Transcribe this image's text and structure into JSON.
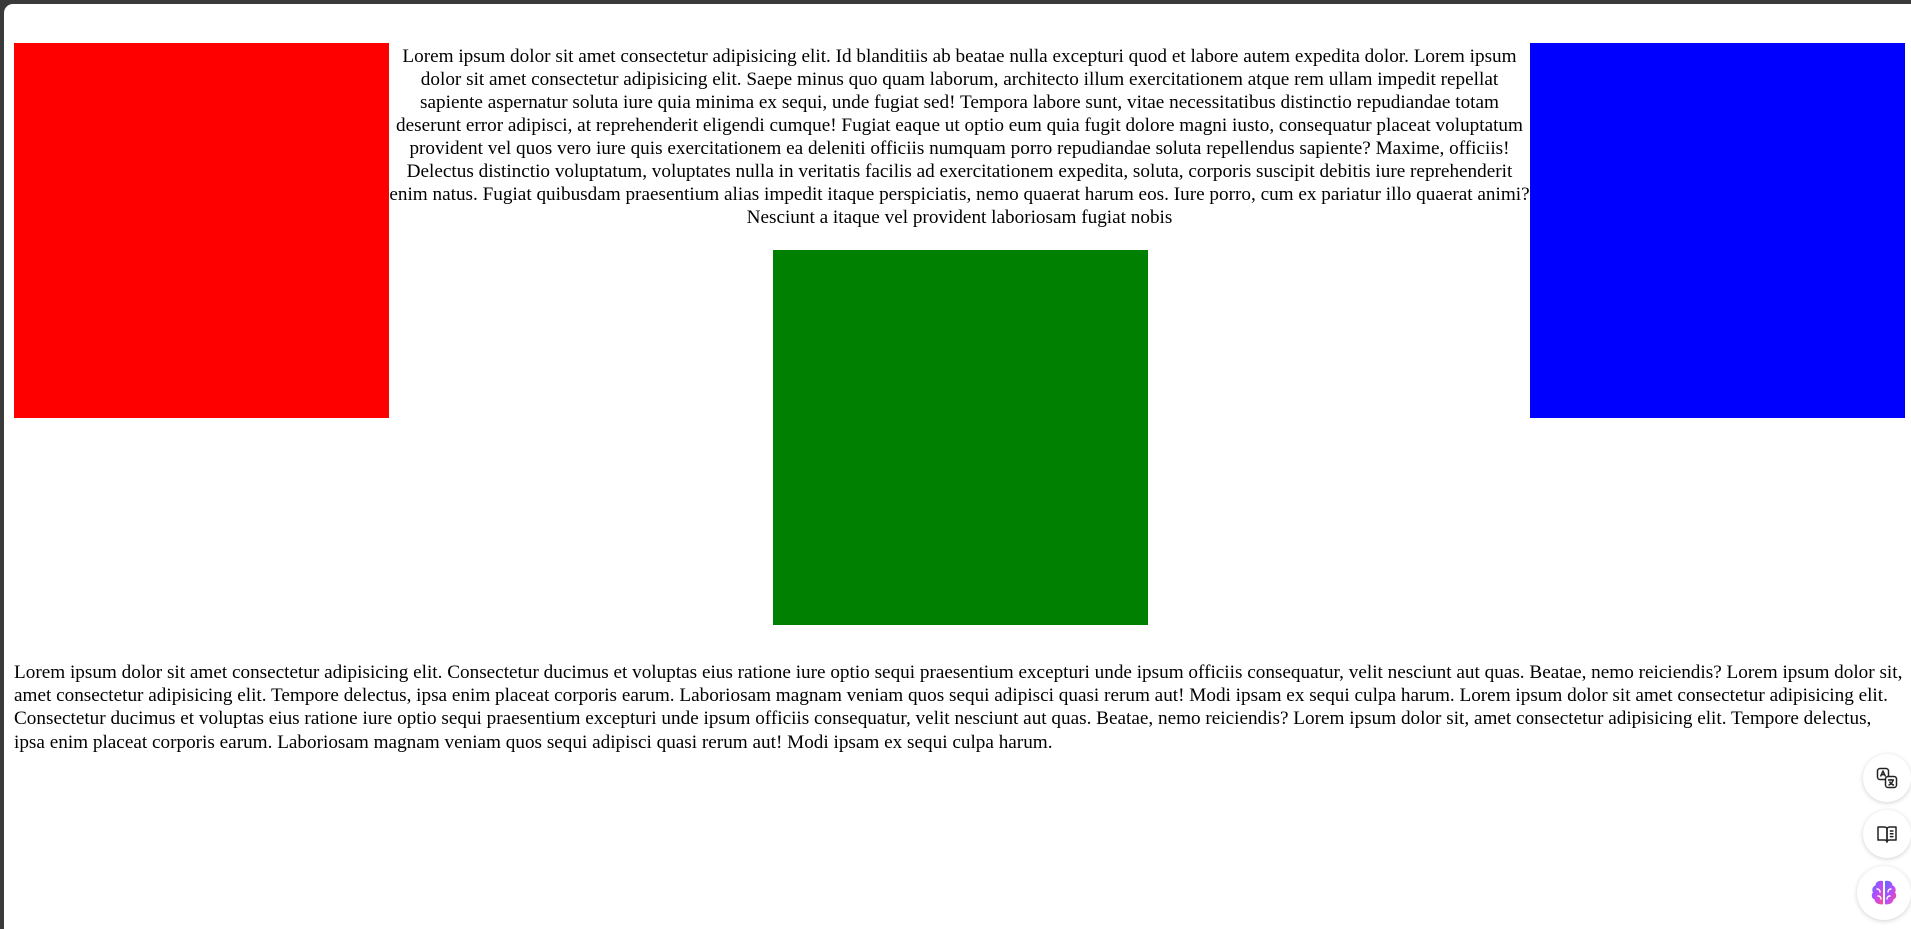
{
  "page": {
    "top_paragraph": "Lorem ipsum dolor sit amet consectetur adipisicing elit. Id blanditiis ab beatae nulla excepturi quod et labore autem expedita dolor. Lorem ipsum dolor sit amet consectetur adipisicing elit. Saepe minus quo quam laborum, architecto illum exercitationem atque rem ullam impedit repellat sapiente aspernatur soluta iure quia minima ex sequi, unde fugiat sed! Tempora labore sunt, vitae necessitatibus distinctio repudiandae totam deserunt error adipisci, at reprehenderit eligendi cumque! Fugiat eaque ut optio eum quia fugit dolore magni iusto, consequatur placeat voluptatum provident vel quos vero iure quis exercitationem ea deleniti officiis numquam porro repudiandae soluta repellendus sapiente? Maxime, officiis! Delectus distinctio voluptatum, voluptates nulla in veritatis facilis ad exercitationem expedita, soluta, corporis suscipit debitis iure reprehenderit enim natus. Fugiat quibusdam praesentium alias impedit itaque perspiciatis, nemo quaerat harum eos. Iure porro, cum ex pariatur illo quaerat animi? Nesciunt a itaque vel provident laboriosam fugiat nobis",
    "bottom_paragraph": "Lorem ipsum dolor sit amet consectetur adipisicing elit. Consectetur ducimus et voluptas eius ratione iure optio sequi praesentium excepturi unde ipsum officiis consequatur, velit nesciunt aut quas. Beatae, nemo reiciendis? Lorem ipsum dolor sit, amet consectetur adipisicing elit. Tempore delectus, ipsa enim placeat corporis earum. Laboriosam magnam veniam quos sequi adipisci quasi rerum aut! Modi ipsam ex sequi culpa harum. Lorem ipsum dolor sit amet consectetur adipisicing elit. Consectetur ducimus et voluptas eius ratione iure optio sequi praesentium excepturi unde ipsum officiis consequatur, velit nesciunt aut quas. Beatae, nemo reiciendis? Lorem ipsum dolor sit, amet consectetur adipisicing elit. Tempore delectus, ipsa enim placeat corporis earum. Laboriosam magnam veniam quos sequi adipisci quasi rerum aut! Modi ipsam ex sequi culpa harum."
  },
  "boxes": {
    "red": "#ff0000",
    "blue": "#0000ff",
    "green": "#008000"
  },
  "side_tools": [
    {
      "icon": "translate-icon"
    },
    {
      "icon": "reader-icon"
    },
    {
      "icon": "ai-brain-icon"
    }
  ]
}
